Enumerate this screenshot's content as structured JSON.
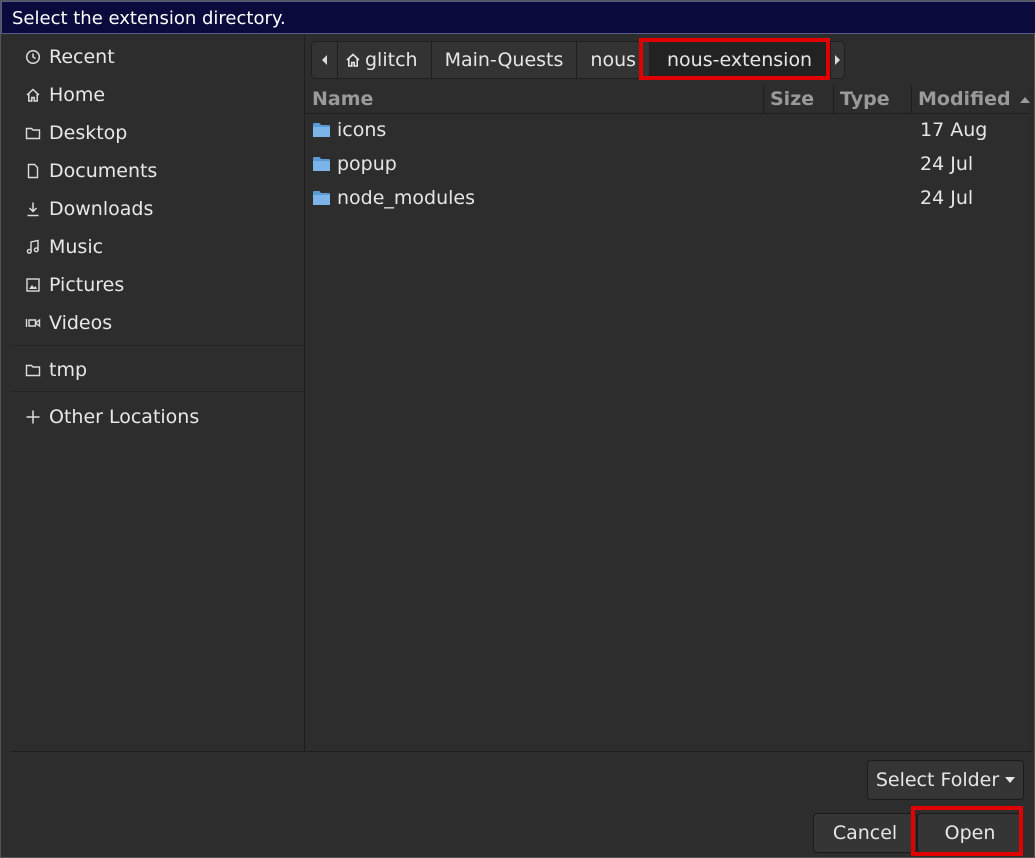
{
  "dialog": {
    "title": "Select the extension directory."
  },
  "sidebar": {
    "items": [
      {
        "label": "Recent",
        "icon": "clock-icon"
      },
      {
        "label": "Home",
        "icon": "home-icon"
      },
      {
        "label": "Desktop",
        "icon": "folder-icon"
      },
      {
        "label": "Documents",
        "icon": "document-icon"
      },
      {
        "label": "Downloads",
        "icon": "download-icon"
      },
      {
        "label": "Music",
        "icon": "music-icon"
      },
      {
        "label": "Pictures",
        "icon": "picture-icon"
      },
      {
        "label": "Videos",
        "icon": "video-icon"
      },
      {
        "label": "tmp",
        "icon": "folder-icon"
      },
      {
        "label": "Other Locations",
        "icon": "plus-icon"
      }
    ]
  },
  "pathbar": {
    "crumbs": [
      "glitch",
      "Main-Quests",
      "nous",
      "nous-extension"
    ],
    "active": "nous-extension"
  },
  "filelist": {
    "columns": {
      "name": "Name",
      "size": "Size",
      "type": "Type",
      "modified": "Modified"
    },
    "sort": "modified-ascending",
    "rows": [
      {
        "name": "icons",
        "size": "",
        "type": "",
        "modified": "17 Aug"
      },
      {
        "name": "popup",
        "size": "",
        "type": "",
        "modified": "24 Jul"
      },
      {
        "name": "node_modules",
        "size": "",
        "type": "",
        "modified": "24 Jul"
      }
    ]
  },
  "footer": {
    "filter_label": "Select Folder",
    "cancel_label": "Cancel",
    "open_label": "Open"
  },
  "colors": {
    "titlebar": "#0a0a3c",
    "background": "#2d2d2d",
    "folder": "#5b9bd5",
    "highlight": "#e00000"
  }
}
